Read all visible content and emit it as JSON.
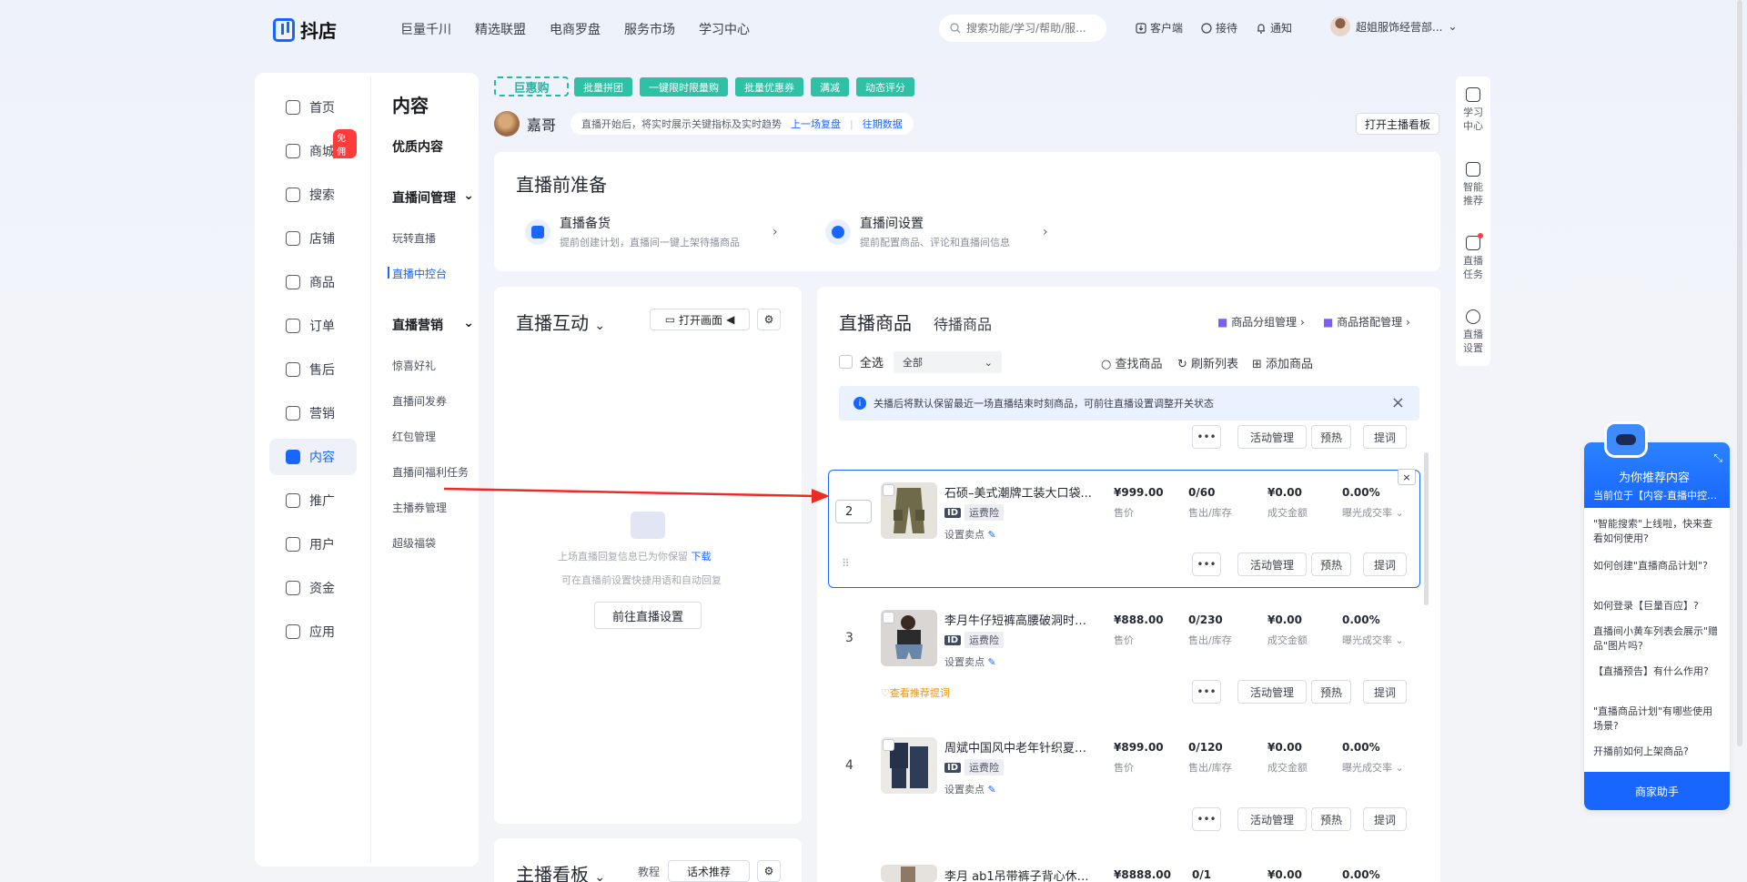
{
  "header": {
    "logo": "抖店",
    "nav": [
      "巨量千川",
      "精选联盟",
      "电商罗盘",
      "服务市场",
      "学习中心"
    ],
    "search_placeholder": "搜索功能/学习/帮助/服...",
    "icons": [
      {
        "icon": "download-icon",
        "label": "客户端"
      },
      {
        "icon": "headset-icon",
        "label": "接待"
      },
      {
        "icon": "bell-icon",
        "label": "通知"
      }
    ],
    "user": "超姐服饰经营部..."
  },
  "leftnav": [
    {
      "label": "首页",
      "icon": "home-icon"
    },
    {
      "label": "商城",
      "icon": "mall-icon",
      "badge": "免佣"
    },
    {
      "label": "搜索",
      "icon": "search-icon"
    },
    {
      "label": "店铺",
      "icon": "shop-icon"
    },
    {
      "label": "商品",
      "icon": "goods-icon"
    },
    {
      "label": "订单",
      "icon": "order-icon"
    },
    {
      "label": "售后",
      "icon": "aftersale-icon"
    },
    {
      "label": "营销",
      "icon": "megaphone-icon"
    },
    {
      "label": "内容",
      "icon": "video-icon",
      "active": true
    },
    {
      "label": "推广",
      "icon": "promote-icon"
    },
    {
      "label": "用户",
      "icon": "user-icon"
    },
    {
      "label": "资金",
      "icon": "wallet-icon"
    },
    {
      "label": "应用",
      "icon": "app-icon"
    }
  ],
  "subnav": {
    "title": "内容",
    "quality": "优质内容",
    "group1": "直播间管理",
    "group1_items": [
      "玩转直播",
      "直播中控台"
    ],
    "group2": "直播营销",
    "group2_items": [
      "惊喜好礼",
      "直播间发券",
      "红包管理",
      "直播间福利任务",
      "主播券管理",
      "超级福袋"
    ]
  },
  "promo": {
    "logo": "巨惠购",
    "tags": [
      "批量拼团",
      "一键限时限量购",
      "批量优惠券",
      "满减",
      "动态评分"
    ]
  },
  "anchor": {
    "name": "嘉哥",
    "tip": "直播开始后，将实时展示关键指标及实时趋势",
    "link1": "上一场复盘",
    "sep": "|",
    "link2": "往期数据",
    "dashboard_btn": "打开主播看板"
  },
  "prep": {
    "title": "直播前准备",
    "items": [
      {
        "title": "直播备货",
        "desc": "提前创建计划，直播间一键上架待播商品"
      },
      {
        "title": "直播间设置",
        "desc": "提前配置商品、评论和直播间信息"
      }
    ]
  },
  "interact": {
    "title": "直播互动",
    "open_screen": "打开画面",
    "empty1": "上场直播回复信息已为你保留",
    "download": "下载",
    "empty2": "可在直播前设置快捷用语和自动回复",
    "goto_btn": "前往直播设置"
  },
  "dashboard2": {
    "title": "主播看板",
    "tutorial": "教程",
    "script_btn": "话术推荐"
  },
  "products": {
    "tab_active": "直播商品",
    "tab_other": "待播商品",
    "group_mgmt": "商品分组管理",
    "combo_mgmt": "商品搭配管理",
    "select_all": "全选",
    "filter": "全部",
    "find": "查找商品",
    "refresh": "刷新列表",
    "add": "添加商品",
    "notice": "关播后将默认保留最近一场直播结束时刻商品，可前往直播设置调整开关状态",
    "btn_more": "•••",
    "btn_activity": "活动管理",
    "btn_preheat": "预热",
    "btn_prompt": "提词",
    "selling_point": "设置卖点",
    "insurance": "运费险",
    "id_tag": "ID",
    "recommend": "查看推荐提词",
    "labels": {
      "price": "售价",
      "sold": "售出/库存",
      "gmv": "成交金额",
      "rate": "曝光成交率"
    },
    "rows": [
      {
        "idx": "2",
        "name": "石硕–美式潮牌工装大口袋...",
        "price": "¥999.00",
        "sold": "0/60",
        "gmv": "¥0.00",
        "rate": "0.00%"
      },
      {
        "idx": "3",
        "name": "李月牛仔短裤高腰破洞时尚...",
        "price": "¥888.00",
        "sold": "0/230",
        "gmv": "¥0.00",
        "rate": "0.00%"
      },
      {
        "idx": "4",
        "name": "周斌中国风中老年针织夏季...",
        "price": "¥899.00",
        "sold": "0/120",
        "gmv": "¥0.00",
        "rate": "0.00%"
      },
      {
        "idx": "5",
        "name": "李月 ab1吊带裤子背心休闲...",
        "price": "¥8888.00",
        "sold": "0/1",
        "gmv": "¥0.00",
        "rate": "0.00%"
      }
    ]
  },
  "rail": [
    {
      "label": "学习中心",
      "icon": "book-icon"
    },
    {
      "label": "智能推荐",
      "icon": "robot-icon"
    },
    {
      "label": "直播任务",
      "icon": "task-icon"
    },
    {
      "label": "直播设置",
      "icon": "settings-icon"
    }
  ],
  "assistant": {
    "title": "为你推荐内容",
    "subtitle": "当前位于【内容-直播中控台】",
    "questions": [
      "\"智能搜索\"上线啦，快来查看如何使用?",
      "如何创建\"直播商品计划\"?",
      "如何登录【巨量百应】?",
      "直播间小黄车列表会展示\"赠品\"图片吗?",
      "【直播预告】有什么作用?",
      "\"直播商品计划\"有哪些使用场景?",
      "开播前如何上架商品?"
    ],
    "button": "商家助手"
  },
  "colors": {
    "brand": "#1966ff",
    "promo": "#2ec1a6",
    "annotation_arrow": "#ee2a24"
  }
}
